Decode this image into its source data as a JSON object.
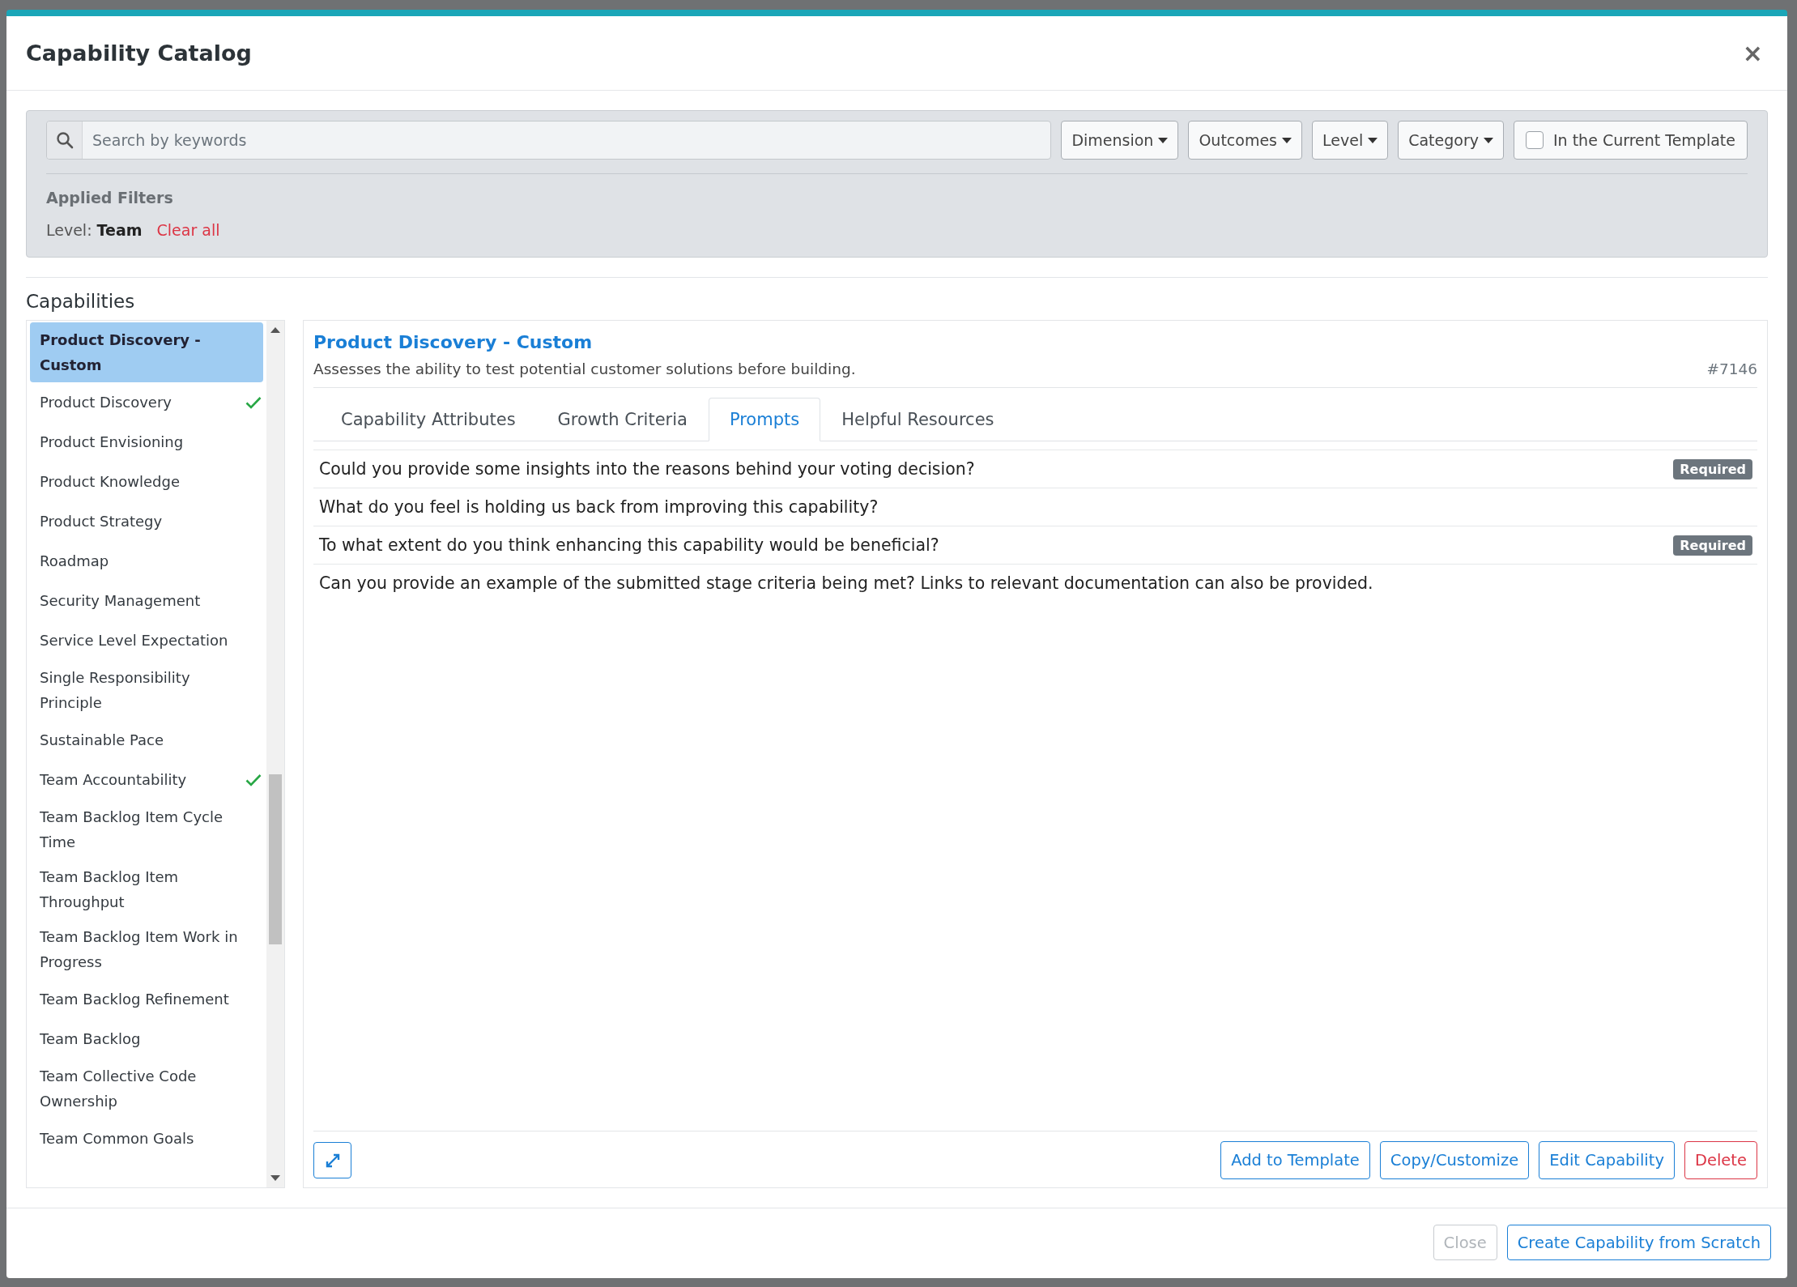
{
  "dialog": {
    "title": "Capability Catalog",
    "close": "×"
  },
  "filters": {
    "search_placeholder": "Search by keywords",
    "dropdowns": [
      "Dimension",
      "Outcomes",
      "Level",
      "Category"
    ],
    "template_checkbox": {
      "label": "In the Current Template",
      "checked": false
    },
    "applied_heading": "Applied Filters",
    "applied": [
      {
        "name": "Level:",
        "value": "Team"
      }
    ],
    "clear_all": "Clear all"
  },
  "capabilities": {
    "heading": "Capabilities",
    "items": [
      {
        "name": "Product Discovery - Custom",
        "selected": true,
        "checked": false
      },
      {
        "name": "Product Discovery",
        "selected": false,
        "checked": true
      },
      {
        "name": "Product Envisioning",
        "selected": false,
        "checked": false
      },
      {
        "name": "Product Knowledge",
        "selected": false,
        "checked": false
      },
      {
        "name": "Product Strategy",
        "selected": false,
        "checked": false
      },
      {
        "name": "Roadmap",
        "selected": false,
        "checked": false
      },
      {
        "name": "Security Management",
        "selected": false,
        "checked": false
      },
      {
        "name": "Service Level Expectation",
        "selected": false,
        "checked": false
      },
      {
        "name": "Single Responsibility Principle",
        "selected": false,
        "checked": false
      },
      {
        "name": "Sustainable Pace",
        "selected": false,
        "checked": false
      },
      {
        "name": "Team Accountability",
        "selected": false,
        "checked": true
      },
      {
        "name": "Team Backlog Item Cycle Time",
        "selected": false,
        "checked": false
      },
      {
        "name": "Team Backlog Item Throughput",
        "selected": false,
        "checked": false
      },
      {
        "name": "Team Backlog Item Work in Progress",
        "selected": false,
        "checked": false
      },
      {
        "name": "Team Backlog Refinement",
        "selected": false,
        "checked": false
      },
      {
        "name": "Team Backlog",
        "selected": false,
        "checked": false
      },
      {
        "name": "Team Collective Code Ownership",
        "selected": false,
        "checked": false
      },
      {
        "name": "Team Common Goals",
        "selected": false,
        "checked": false
      }
    ]
  },
  "detail": {
    "title": "Product Discovery - Custom",
    "description": "Assesses the ability to test potential customer solutions before building.",
    "id": "#7146",
    "tabs": [
      {
        "label": "Capability Attributes",
        "selected": false
      },
      {
        "label": "Growth Criteria",
        "selected": false
      },
      {
        "label": "Prompts",
        "selected": true
      },
      {
        "label": "Helpful Resources",
        "selected": false
      }
    ],
    "prompts": [
      {
        "text": "Could you provide some insights into the reasons behind your voting decision?",
        "badge": "Required"
      },
      {
        "text": "What do you feel is holding us back from improving this capability?"
      },
      {
        "text": "To what extent do you think enhancing this capability would be beneficial?",
        "badge": "Required"
      },
      {
        "text": "Can you provide an example of the submitted stage criteria being met? Links to relevant documentation can also be provided."
      }
    ],
    "actions": [
      {
        "label": "Add to Template",
        "kind": "primary"
      },
      {
        "label": "Copy/Customize",
        "kind": "primary"
      },
      {
        "label": "Edit Capability",
        "kind": "primary"
      },
      {
        "label": "Delete",
        "kind": "danger"
      }
    ]
  },
  "footer": {
    "buttons": [
      {
        "label": "Close",
        "disabled": true
      },
      {
        "label": "Create Capability from Scratch",
        "disabled": false
      }
    ]
  }
}
